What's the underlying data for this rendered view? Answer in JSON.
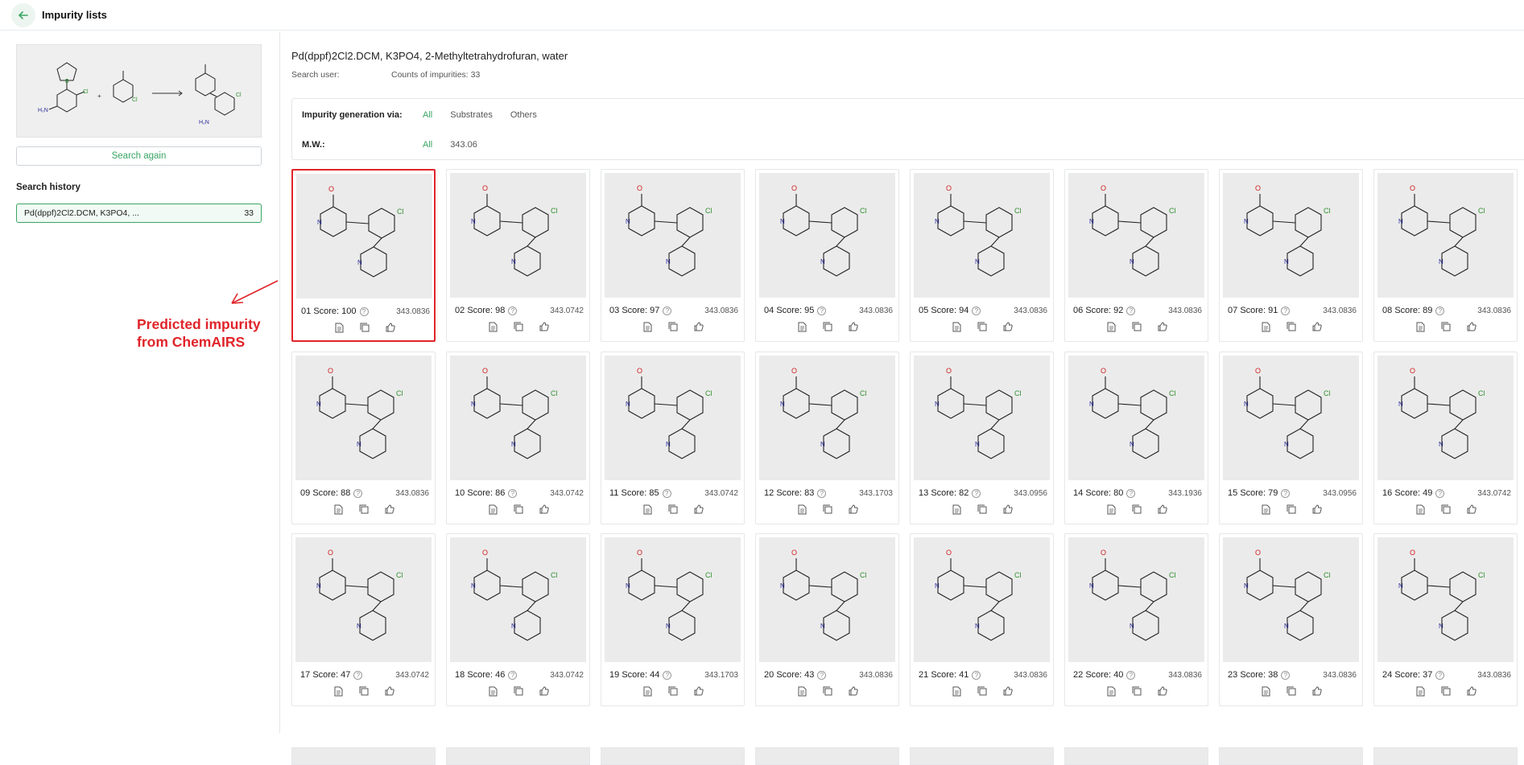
{
  "header": {
    "title": "Impurity lists"
  },
  "sidebar": {
    "search_again": "Search again",
    "history_label": "Search history",
    "history": [
      {
        "label": "Pd(dppf)2Cl2.DCM, K3PO4, ...",
        "count": "33"
      }
    ]
  },
  "annotation": {
    "line1": "Predicted impurity",
    "line2": "from ChemAIRS"
  },
  "main": {
    "conditions": "Pd(dppf)2Cl2.DCM, K3PO4, 2-Methyltetrahydrofuran, water",
    "search_user_label": "Search user:",
    "count_label": "Counts of impurities: 33",
    "filters": {
      "generation_label": "Impurity generation via:",
      "generation_options": [
        "All",
        "Substrates",
        "Others"
      ],
      "mw_label": "M.W.:",
      "mw_options": [
        "All",
        "343.06"
      ]
    }
  },
  "cards": [
    {
      "idx": "01",
      "score": "Score: 100",
      "mw": "343.0836"
    },
    {
      "idx": "02",
      "score": "Score: 98",
      "mw": "343.0742"
    },
    {
      "idx": "03",
      "score": "Score: 97",
      "mw": "343.0836"
    },
    {
      "idx": "04",
      "score": "Score: 95",
      "mw": "343.0836"
    },
    {
      "idx": "05",
      "score": "Score: 94",
      "mw": "343.0836"
    },
    {
      "idx": "06",
      "score": "Score: 92",
      "mw": "343.0836"
    },
    {
      "idx": "07",
      "score": "Score: 91",
      "mw": "343.0836"
    },
    {
      "idx": "08",
      "score": "Score: 89",
      "mw": "343.0836"
    },
    {
      "idx": "09",
      "score": "Score: 88",
      "mw": "343.0836"
    },
    {
      "idx": "10",
      "score": "Score: 86",
      "mw": "343.0742"
    },
    {
      "idx": "11",
      "score": "Score: 85",
      "mw": "343.0742"
    },
    {
      "idx": "12",
      "score": "Score: 83",
      "mw": "343.1703"
    },
    {
      "idx": "13",
      "score": "Score: 82",
      "mw": "343.0956"
    },
    {
      "idx": "14",
      "score": "Score: 80",
      "mw": "343.1936"
    },
    {
      "idx": "15",
      "score": "Score: 79",
      "mw": "343.0956"
    },
    {
      "idx": "16",
      "score": "Score: 49",
      "mw": "343.0742"
    },
    {
      "idx": "17",
      "score": "Score: 47",
      "mw": "343.0742"
    },
    {
      "idx": "18",
      "score": "Score: 46",
      "mw": "343.0742"
    },
    {
      "idx": "19",
      "score": "Score: 44",
      "mw": "343.1703"
    },
    {
      "idx": "20",
      "score": "Score: 43",
      "mw": "343.0836"
    },
    {
      "idx": "21",
      "score": "Score: 41",
      "mw": "343.0836"
    },
    {
      "idx": "22",
      "score": "Score: 40",
      "mw": "343.0836"
    },
    {
      "idx": "23",
      "score": "Score: 38",
      "mw": "343.0836"
    },
    {
      "idx": "24",
      "score": "Score: 37",
      "mw": "343.0836"
    }
  ],
  "colors": {
    "accent": "#3aa564",
    "highlight": "#e0242a"
  },
  "icons": {
    "back": "arrow-left-icon",
    "help": "question-circle-icon",
    "actions": [
      "document-icon",
      "copy-icon",
      "thumbs-up-icon"
    ]
  }
}
